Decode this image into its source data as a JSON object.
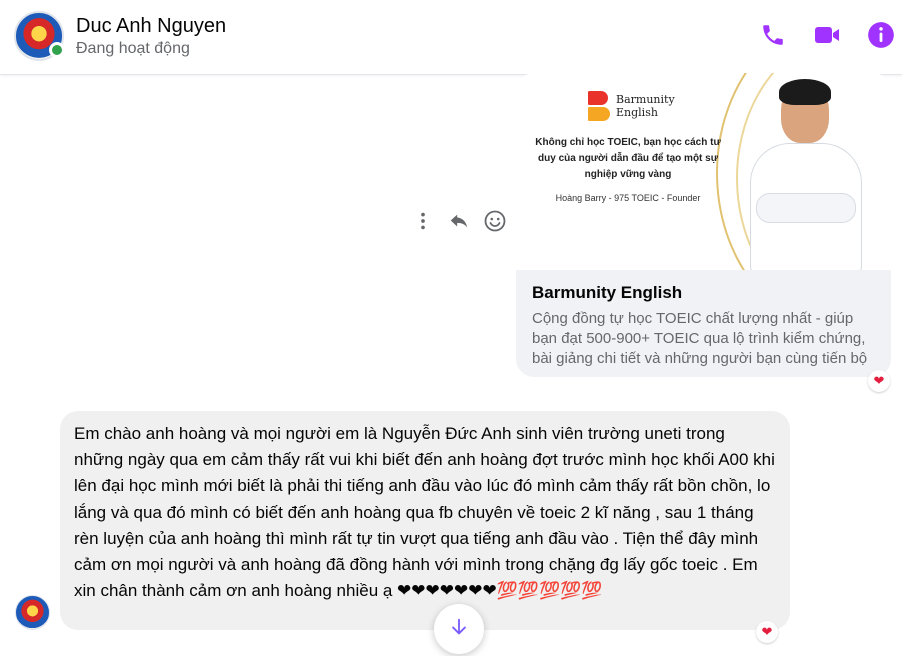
{
  "header": {
    "name": "Duc Anh Nguyen",
    "status": "Đang hoạt động",
    "accent_color": "#a033ff",
    "icons": [
      "phone-icon",
      "video-call-icon",
      "info-icon"
    ]
  },
  "link_preview": {
    "banner": {
      "brand": "Barmunity\nEnglish",
      "headline": "Không chỉ học TOEIC, bạn học cách tư duy của người dẫn đầu để tạo một sự nghiệp vững vàng",
      "signature": "Hoàng Barry - 975 TOEIC - Founder"
    },
    "title": "Barmunity English",
    "description": "Cộng đồng tự học TOEIC chất lượng nhất - giúp bạn đạt 500-900+ TOEIC qua lộ trình kiểm chứng, bài giảng chi tiết và những người bạn cùng tiến bộ",
    "reaction": "❤"
  },
  "message_actions": {
    "icons": [
      "more-icon",
      "reply-icon",
      "emoji-icon"
    ]
  },
  "incoming_message": {
    "text": "Em chào anh hoàng và mọi người em là Nguyễn Đức Anh sinh viên trường uneti trong những ngày qua em cảm thấy rất vui khi biết đến anh hoàng đợt trước mình học khối A00 khi lên đại học mình mới biết là phải thi tiếng anh đầu vào lúc đó mình cảm thấy rất bồn chồn, lo lắng và qua đó mình có biết đến anh hoàng qua fb chuyên về toeic 2 kĩ năng , sau 1 tháng rèn luyện của anh hoàng thì mình rất tự tin vượt qua tiếng anh đầu vào . Tiện thể đây mình cảm ơn mọi người và anh hoàng đã đồng hành với mình trong chặng đg lấy gốc toeic . Em xin chân thành cảm ơn anh hoàng nhiều ạ ❤❤❤❤❤❤❤💯💯💯💯💯",
    "reaction": "❤"
  },
  "scroll_button": {
    "icon": "arrow-down-icon"
  }
}
